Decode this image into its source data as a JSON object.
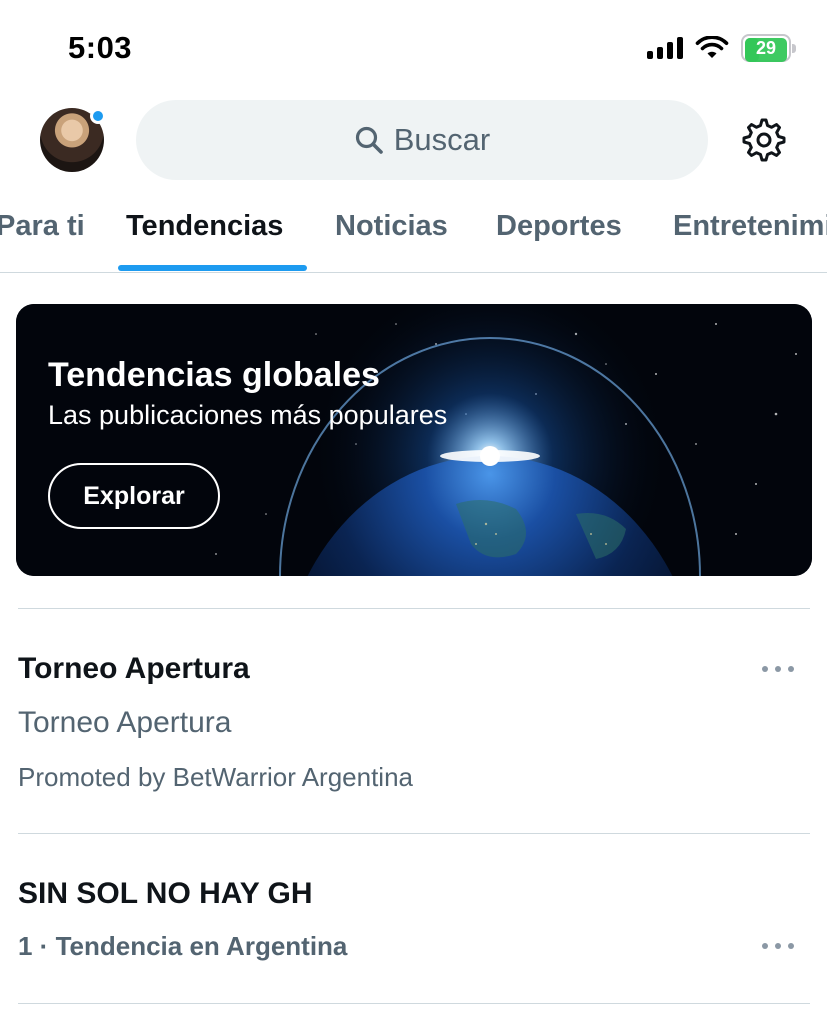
{
  "status_bar": {
    "time": "5:03",
    "battery": "29"
  },
  "header": {
    "search_placeholder": "Buscar"
  },
  "tabs": [
    {
      "label": "Para ti"
    },
    {
      "label": "Tendencias"
    },
    {
      "label": "Noticias"
    },
    {
      "label": "Deportes"
    },
    {
      "label": "Entretenimiento"
    }
  ],
  "active_tab": "Tendencias",
  "banner": {
    "title": "Tendencias globales",
    "subtitle": "Las publicaciones más populares",
    "button": "Explorar"
  },
  "trends": [
    {
      "title": "Torneo Apertura",
      "subtitle": "Torneo Apertura",
      "promoted": "Promoted by BetWarrior Argentina"
    },
    {
      "title": "SIN SOL NO HAY GH",
      "context": "1 · Tendencia en Argentina"
    }
  ],
  "colors": {
    "accent": "#1d9bf0",
    "battery": "#34c759",
    "muted": "#536471"
  },
  "icons": [
    "signal-icon",
    "wifi-icon",
    "battery-icon",
    "search-icon",
    "gear-icon",
    "more-icon"
  ]
}
